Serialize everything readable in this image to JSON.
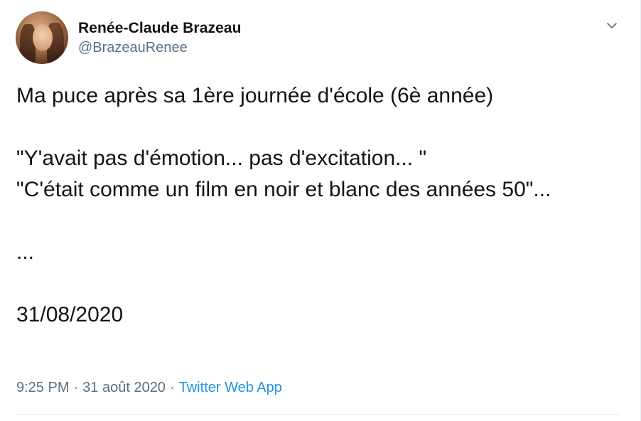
{
  "author": {
    "display_name": "Renée-Claude Brazeau",
    "handle": "@BrazeauRenee"
  },
  "tweet": {
    "text": "Ma puce après sa 1ère journée d'école (6è année)\n\n\"Y'avait pas d'émotion... pas d'excitation... \"\n\"C'était comme un film en noir et blanc des années 50\"...\n\n...\n\n31/08/2020"
  },
  "meta": {
    "time": "9:25 PM",
    "separator": "·",
    "date": "31 août 2020",
    "source": "Twitter Web App"
  },
  "icons": {
    "more_menu": "chevron-down-icon"
  },
  "colors": {
    "text_primary": "#0f1419",
    "text_secondary": "#5b7083",
    "link": "#1b95e0",
    "divider": "#e6ecf0"
  }
}
